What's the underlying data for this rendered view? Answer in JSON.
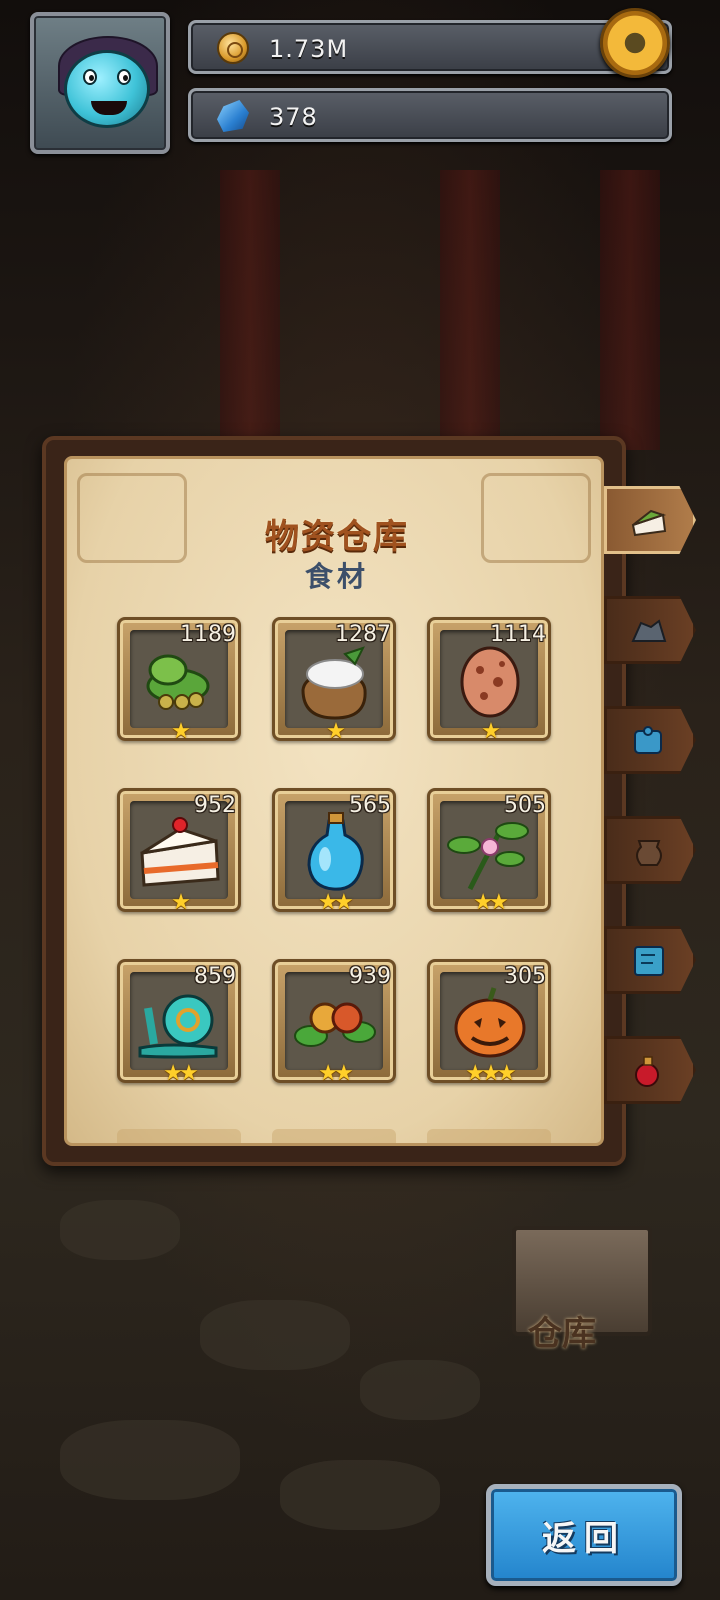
{
  "hud": {
    "coins_value": "1.73M",
    "gems_value": "378",
    "icons": {
      "coin": "coin-icon",
      "gem": "gem-icon",
      "settings": "gear-icon",
      "avatar": "avatar-icon"
    }
  },
  "panel": {
    "title": "物资仓库",
    "subtitle": "食材",
    "items": [
      {
        "icon": "green-beans-icon",
        "count": "1189",
        "stars": "★"
      },
      {
        "icon": "flour-sack-icon",
        "count": "1287",
        "stars": "★"
      },
      {
        "icon": "spotted-egg-icon",
        "count": "1114",
        "stars": "★"
      },
      {
        "icon": "cake-slice-icon",
        "count": "952",
        "stars": "★"
      },
      {
        "icon": "blue-potion-icon",
        "count": "565",
        "stars": "★★"
      },
      {
        "icon": "flower-sprig-icon",
        "count": "505",
        "stars": "★★"
      },
      {
        "icon": "teal-snail-icon",
        "count": "859",
        "stars": "★★"
      },
      {
        "icon": "berry-leaves-icon",
        "count": "939",
        "stars": "★★"
      },
      {
        "icon": "pumpkin-icon",
        "count": "305",
        "stars": "★★★"
      }
    ]
  },
  "side_tabs": [
    {
      "icon": "cake-tab-icon",
      "active": true
    },
    {
      "icon": "ore-tab-icon",
      "active": false
    },
    {
      "icon": "puzzle-tab-icon",
      "active": false
    },
    {
      "icon": "pot-tab-icon",
      "active": false
    },
    {
      "icon": "stone-tablet-tab-icon",
      "active": false
    },
    {
      "icon": "red-potion-tab-icon",
      "active": false
    }
  ],
  "storage_label": "仓库",
  "back_button_label": "返回",
  "colors": {
    "title": "#a0521f",
    "subtitle": "#3c4f6a",
    "star": "#ffcf2a",
    "back_button": "#2384cc"
  }
}
